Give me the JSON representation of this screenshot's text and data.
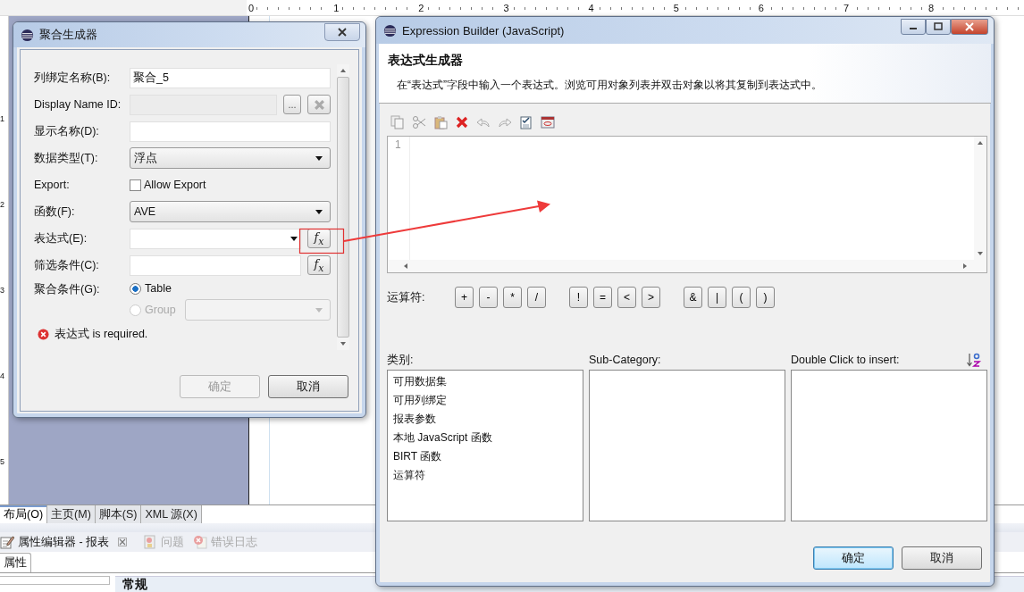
{
  "ruler": {
    "top_marks": [
      "0",
      "1",
      "2",
      "3",
      "4",
      "5",
      "6",
      "7",
      "8"
    ],
    "side_marks": [
      "1",
      "2",
      "3",
      "4",
      "5"
    ]
  },
  "editor_tabs": [
    {
      "label": "布局(O)",
      "selected": true
    },
    {
      "label": "主页(M)",
      "selected": false
    },
    {
      "label": "脚本(S)",
      "selected": false
    },
    {
      "label": "XML 源(X)",
      "selected": false
    }
  ],
  "panel_tabs": [
    {
      "label": "属性编辑器 - 报表",
      "selected": true,
      "kind": "editor"
    },
    {
      "label": "问题",
      "selected": false,
      "kind": "problems"
    },
    {
      "label": "错误日志",
      "selected": false,
      "kind": "log"
    }
  ],
  "property_tabs": [
    {
      "label": "属性",
      "selected": true
    }
  ],
  "property_section": "常规",
  "aggregation_dialog": {
    "title": "聚合生成器",
    "fields": [
      {
        "kind": "text",
        "label": "列绑定名称(B):",
        "value": "聚合_5"
      },
      {
        "kind": "text-buttons",
        "label": "Display Name ID:",
        "disabled": true,
        "button": "..."
      },
      {
        "kind": "text",
        "label": "显示名称(D):"
      },
      {
        "kind": "select",
        "label": "数据类型(T):",
        "value": "浮点"
      },
      {
        "kind": "checkbox",
        "label": "Export:",
        "option": "Allow Export",
        "checked": false
      },
      {
        "kind": "select",
        "label": "函数(F):",
        "value": "AVE"
      },
      {
        "kind": "combo-fx",
        "label": "表达式(E):",
        "button": "f$_{x}$",
        "highlighted": true
      },
      {
        "kind": "text-fx",
        "label": "筛选条件(C):",
        "button": "f$_{x}$"
      },
      {
        "kind": "radios",
        "label": "聚合条件(G):",
        "options": [
          {
            "label": "Table",
            "selected": true,
            "disabled": false
          },
          {
            "label": "Group",
            "selected": false,
            "disabled": true
          }
        ]
      }
    ],
    "error": "表达式 is required.",
    "buttons": [
      {
        "label": "确定",
        "disabled": true
      },
      {
        "label": "取消",
        "disabled": false
      }
    ]
  },
  "expression_dialog": {
    "title": "Expression Builder (JavaScript)",
    "heading": "表达式生成器",
    "description": "在“表达式”字段中输入一个表达式。浏览可用对象列表并双击对象以将其复制到表达式中。",
    "line_numbers": [
      "1"
    ],
    "operators_label": "运算符:",
    "operator_groups": [
      [
        "+",
        "-",
        "*",
        "/"
      ],
      [
        "!",
        "=",
        "<",
        ">"
      ],
      [
        "&",
        "|",
        "(",
        ")"
      ]
    ],
    "columns": [
      {
        "label": "类别:",
        "items": [
          "可用数据集",
          "可用列绑定",
          "报表参数",
          "本地 JavaScript 函数",
          "BIRT 函数",
          "运算符"
        ]
      },
      {
        "label": "Sub-Category:"
      },
      {
        "label": "Double Click to insert:"
      }
    ],
    "buttons": [
      {
        "label": "确定",
        "default": true
      },
      {
        "label": "取消",
        "default": false
      }
    ]
  }
}
